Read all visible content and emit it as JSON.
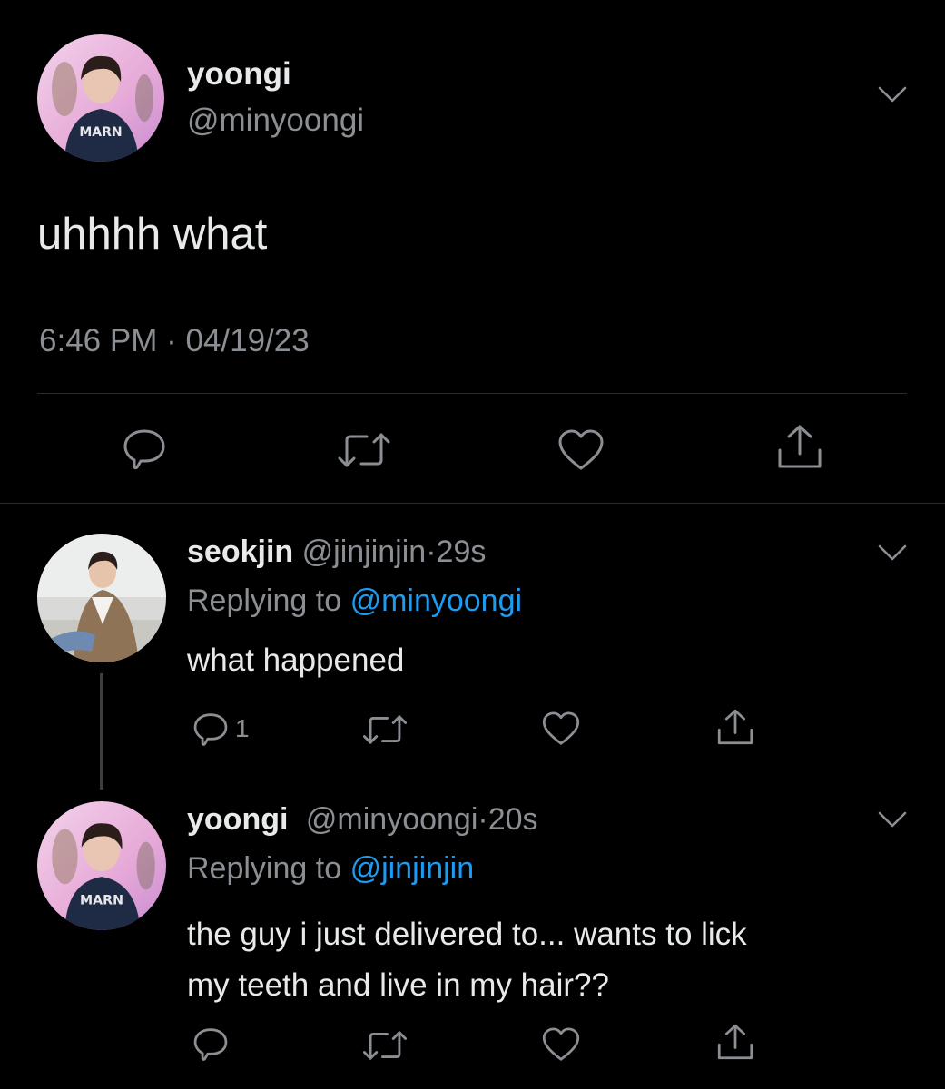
{
  "main_tweet": {
    "display_name": "yoongi",
    "handle": "@minyoongi",
    "text": "uhhhh what",
    "time": "6:46 PM",
    "separator": "·",
    "date": "04/19/23",
    "avatar_text": "MARN"
  },
  "replies": [
    {
      "display_name": "seokjin",
      "handle": "@jinjinjin",
      "dot": "·",
      "age": "29s",
      "replying_prefix": "Replying to",
      "replying_to": "@minyoongi",
      "text": "what happened",
      "reply_count": "1"
    },
    {
      "display_name": "yoongi",
      "handle": "@minyoongi",
      "dot": "·",
      "age": "20s",
      "replying_prefix": "Replying to",
      "replying_to": "@jinjinjin",
      "text_line1": "the guy i just delivered to... wants to lick",
      "text_line2": "my teeth and live in my hair??",
      "avatar_text": "MARN"
    }
  ],
  "colors": {
    "background": "#000000",
    "link": "#1d9bf0",
    "muted": "#8b8f94",
    "icon": "#8b8f94"
  },
  "icons": [
    "chevron-down-icon",
    "reply-icon",
    "retweet-icon",
    "like-icon",
    "share-icon"
  ]
}
